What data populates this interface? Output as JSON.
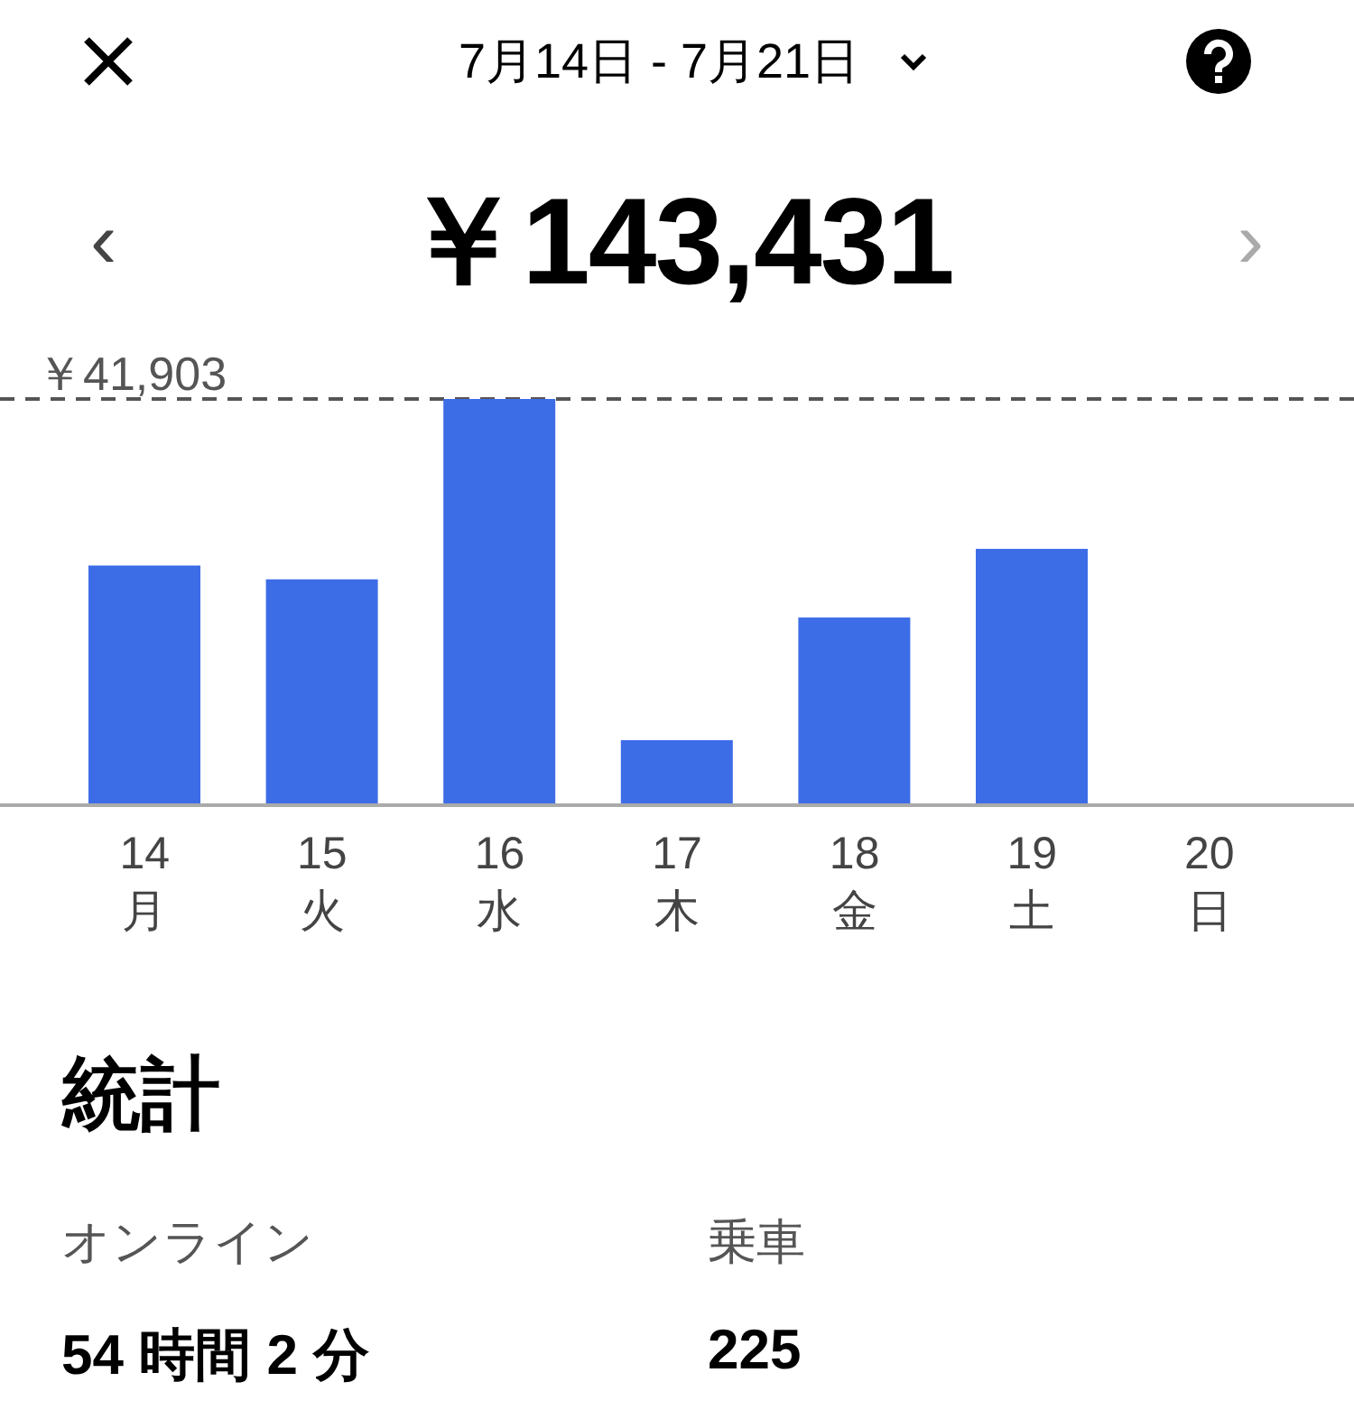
{
  "header": {
    "date_range": "7月14日 - 7月21日"
  },
  "summary": {
    "previous": "‹",
    "total": "￥143,431",
    "next": "›"
  },
  "chart": {
    "max_label": "￥41,903",
    "days": [
      {
        "day": "14",
        "weekday": "月"
      },
      {
        "day": "15",
        "weekday": "火"
      },
      {
        "day": "16",
        "weekday": "水"
      },
      {
        "day": "17",
        "weekday": "木"
      },
      {
        "day": "18",
        "weekday": "金"
      },
      {
        "day": "19",
        "weekday": "土"
      },
      {
        "day": "20",
        "weekday": "日"
      }
    ]
  },
  "stats": {
    "title": "統計",
    "items": [
      {
        "label": "オンライン",
        "value": "54 時間 2 分"
      },
      {
        "label": "乗車",
        "value": "225"
      }
    ]
  }
}
